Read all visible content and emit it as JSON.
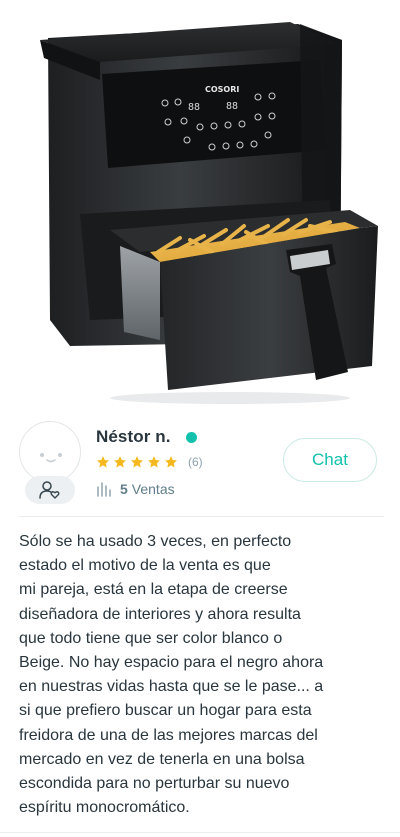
{
  "product_image": {
    "brand_label": "COSORI",
    "display_left": "88",
    "display_right": "88"
  },
  "seller": {
    "name": "Néstor n.",
    "online": true,
    "rating_stars": 5,
    "rating_count": "(6)",
    "sales_count": "5",
    "sales_label": "Ventas",
    "chat_label": "Chat"
  },
  "colors": {
    "accent": "#13c1ac",
    "star": "#f5b81e",
    "text": "#29363d",
    "muted": "#607d8b"
  },
  "icons": {
    "avatar_badge": "user-heart-icon",
    "sales": "bar-chart-icon",
    "rating": "star-icon",
    "online": "online-dot-icon"
  },
  "description": {
    "lines": [
      "Sólo se ha usado 3 veces, en perfecto",
      "estado el motivo de la venta es que",
      "mi pareja, está en la etapa de creerse",
      "diseñadora de interiores y ahora resulta",
      "que todo tiene que ser color blanco o",
      "Beige. No hay espacio para el negro ahora",
      "en nuestras vidas hasta que se le pase... a",
      "si que prefiero buscar un hogar para esta",
      "freidora de una de las mejores marcas del",
      "mercado en vez de tenerla en una bolsa",
      "escondida para no perturbar su nuevo",
      "espíritu monocromático."
    ]
  }
}
